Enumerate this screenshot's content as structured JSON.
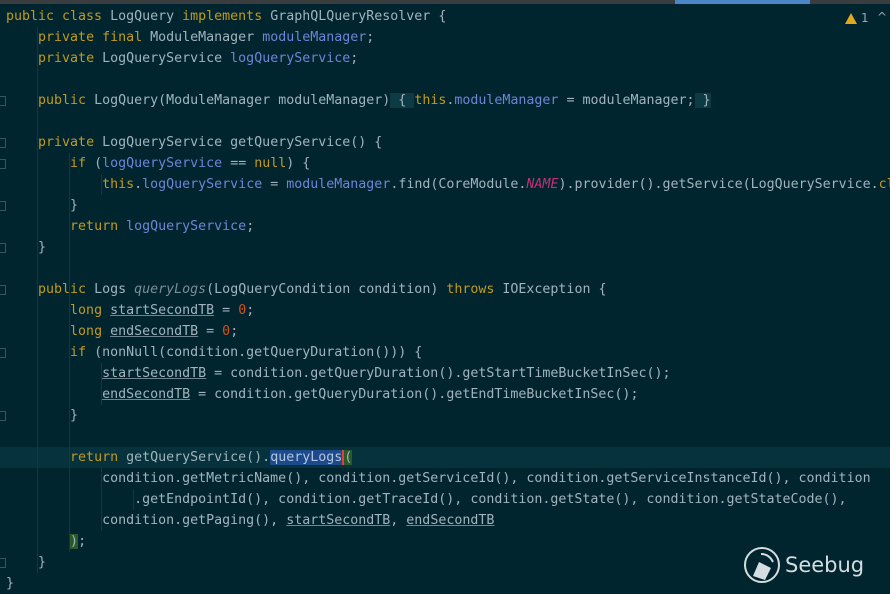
{
  "editor": {
    "warning_count": "1",
    "current_line": 21,
    "lines": [
      [
        [
          "public class ",
          "k"
        ],
        [
          "LogQuery ",
          "p"
        ],
        [
          "implements ",
          "k"
        ],
        [
          "GraphQLQueryResolver {",
          "p"
        ]
      ],
      [
        [
          "    ",
          "p"
        ],
        [
          "private final ",
          "k"
        ],
        [
          "ModuleManager ",
          "p"
        ],
        [
          "moduleManager",
          "f"
        ],
        [
          ";",
          "p"
        ]
      ],
      [
        [
          "    ",
          "p"
        ],
        [
          "private ",
          "k"
        ],
        [
          "LogQueryService ",
          "p"
        ],
        [
          "logQueryService",
          "f"
        ],
        [
          ";",
          "p"
        ]
      ],
      [],
      [
        [
          "    ",
          "p"
        ],
        [
          "public ",
          "k"
        ],
        [
          "LogQuery(ModuleManager moduleManager)",
          "p"
        ],
        [
          " { ",
          "b"
        ],
        [
          "this",
          "k"
        ],
        [
          ".",
          "p"
        ],
        [
          "moduleManager",
          "f"
        ],
        [
          " = moduleManager;",
          "p"
        ],
        [
          " }",
          "b"
        ]
      ],
      [],
      [
        [
          "    ",
          "p"
        ],
        [
          "private ",
          "k"
        ],
        [
          "LogQueryService getQueryService() {",
          "p"
        ]
      ],
      [
        [
          "        ",
          "p"
        ],
        [
          "if ",
          "k"
        ],
        [
          "(",
          "p"
        ],
        [
          "logQueryService",
          "f"
        ],
        [
          " == ",
          "p"
        ],
        [
          "null",
          "k"
        ],
        [
          ") {",
          "p"
        ]
      ],
      [
        [
          "            ",
          "p"
        ],
        [
          "this",
          "k"
        ],
        [
          ".",
          "p"
        ],
        [
          "logQueryService",
          "f"
        ],
        [
          " = ",
          "p"
        ],
        [
          "moduleManager",
          "f"
        ],
        [
          ".find(CoreModule.",
          "p"
        ],
        [
          "NAME",
          "c"
        ],
        [
          ").provider().getService(LogQueryService.",
          "p"
        ],
        [
          "cl",
          "k"
        ]
      ],
      [
        [
          "        }",
          "p"
        ]
      ],
      [
        [
          "        ",
          "p"
        ],
        [
          "return ",
          "k"
        ],
        [
          "logQueryService",
          "f"
        ],
        [
          ";",
          "p"
        ]
      ],
      [
        [
          "    }",
          "p"
        ]
      ],
      [],
      [
        [
          "    ",
          "p"
        ],
        [
          "public ",
          "k"
        ],
        [
          "Logs ",
          "p"
        ],
        [
          "queryLogs",
          "d"
        ],
        [
          "(LogQueryCondition condition) ",
          "p"
        ],
        [
          "throws ",
          "k"
        ],
        [
          "IOException {",
          "p"
        ]
      ],
      [
        [
          "        ",
          "p"
        ],
        [
          "long ",
          "k"
        ],
        [
          "startSecondTB",
          "u"
        ],
        [
          " = ",
          "p"
        ],
        [
          "0",
          "n"
        ],
        [
          ";",
          "p"
        ]
      ],
      [
        [
          "        ",
          "p"
        ],
        [
          "long ",
          "k"
        ],
        [
          "endSecondTB",
          "u"
        ],
        [
          " = ",
          "p"
        ],
        [
          "0",
          "n"
        ],
        [
          ";",
          "p"
        ]
      ],
      [
        [
          "        ",
          "p"
        ],
        [
          "if ",
          "k"
        ],
        [
          "(nonNull(condition.getQueryDuration())) {",
          "p"
        ]
      ],
      [
        [
          "            ",
          "p"
        ],
        [
          "startSecondTB",
          "u"
        ],
        [
          " = condition.getQueryDuration().getStartTimeBucketInSec();",
          "p"
        ]
      ],
      [
        [
          "            ",
          "p"
        ],
        [
          "endSecondTB",
          "u"
        ],
        [
          " = condition.getQueryDuration().getEndTimeBucketInSec();",
          "p"
        ]
      ],
      [
        [
          "        }",
          "p"
        ]
      ],
      [],
      [
        [
          "        ",
          "p"
        ],
        [
          "return ",
          "k"
        ],
        [
          "getQueryService().",
          "p"
        ],
        [
          "queryLogs",
          "s"
        ],
        [
          "(",
          "m"
        ]
      ],
      [
        [
          "            condition.getMetricName(), condition.getServiceId(), condition.getServiceInstanceId(), condition",
          "p"
        ]
      ],
      [
        [
          "                .getEndpointId(), condition.getTraceId(), condition.getState(), condition.getStateCode(),",
          "p"
        ]
      ],
      [
        [
          "            condition.getPaging(), ",
          "p"
        ],
        [
          "startSecondTB",
          "u"
        ],
        [
          ", ",
          "p"
        ],
        [
          "endSecondTB",
          "u"
        ]
      ],
      [
        [
          "        ",
          "p"
        ],
        [
          ")",
          "m"
        ],
        [
          ";",
          "p"
        ]
      ],
      [
        [
          "    }",
          "p"
        ]
      ],
      [
        [
          "}",
          "p"
        ]
      ]
    ]
  },
  "watermark": {
    "text": "Seebug"
  },
  "colors": {
    "background": "#00252f",
    "keyword": "#c39a1e",
    "field": "#6f84d6",
    "number": "#d2521e",
    "constant": "#c2307a",
    "selection": "#1c4a8c"
  }
}
